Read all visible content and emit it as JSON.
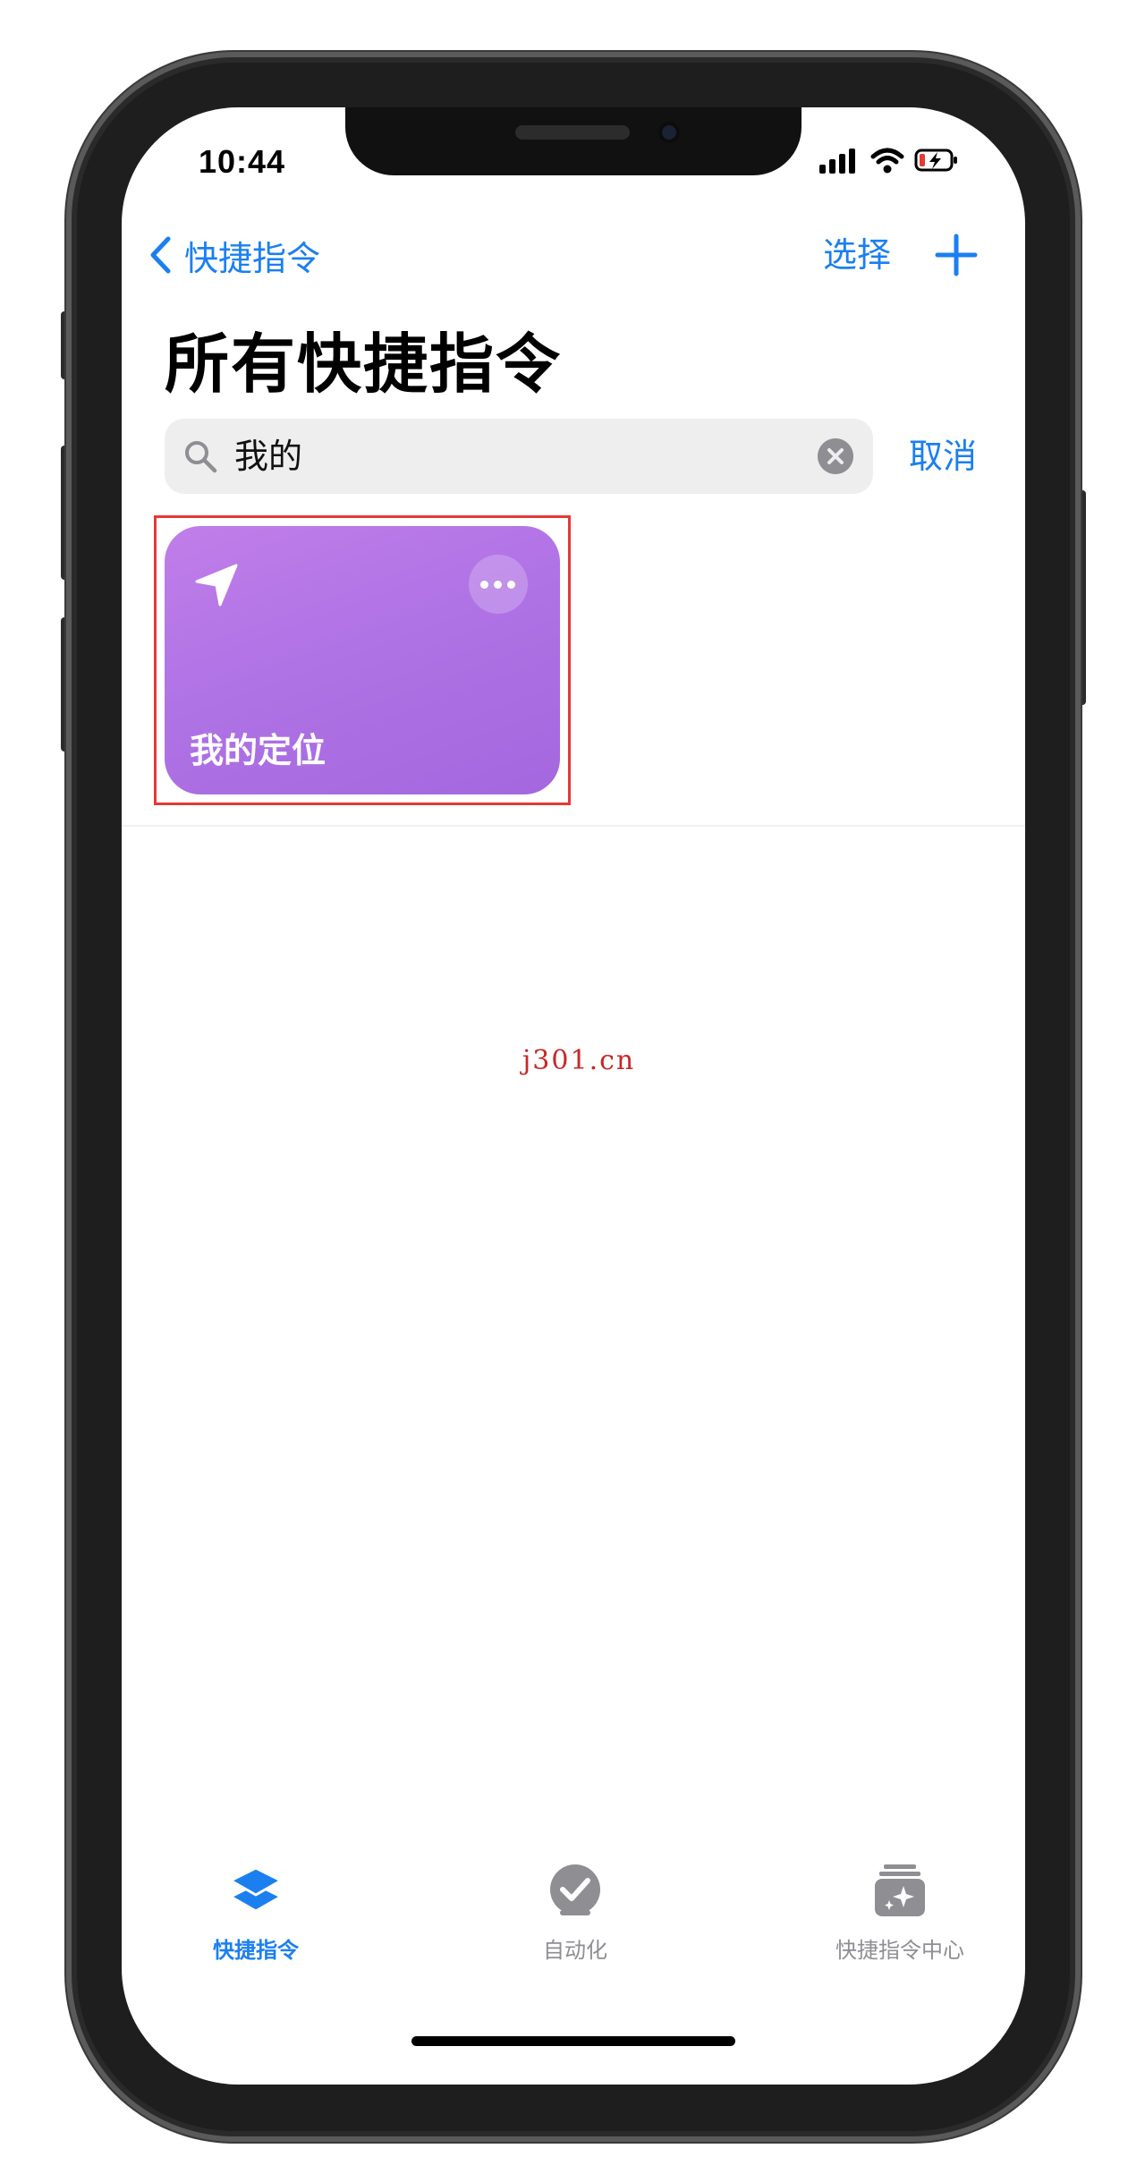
{
  "status_bar": {
    "time": "10:44"
  },
  "nav": {
    "back_label": "快捷指令",
    "select_label": "选择"
  },
  "page": {
    "title": "所有快捷指令"
  },
  "search": {
    "value": "我的",
    "cancel_label": "取消"
  },
  "shortcuts": [
    {
      "name": "我的定位",
      "icon": "location-arrow-icon",
      "color": "#b073e5"
    }
  ],
  "watermark": "j301.cn",
  "tabs": [
    {
      "label": "快捷指令",
      "icon": "layers-icon",
      "active": true
    },
    {
      "label": "自动化",
      "icon": "automation-check-icon",
      "active": false
    },
    {
      "label": "快捷指令中心",
      "icon": "gallery-sparkle-icon",
      "active": false
    }
  ],
  "colors": {
    "accent": "#1b7ff0",
    "card": "#b073e5",
    "highlight_border": "#e53935",
    "watermark": "#c62828"
  }
}
